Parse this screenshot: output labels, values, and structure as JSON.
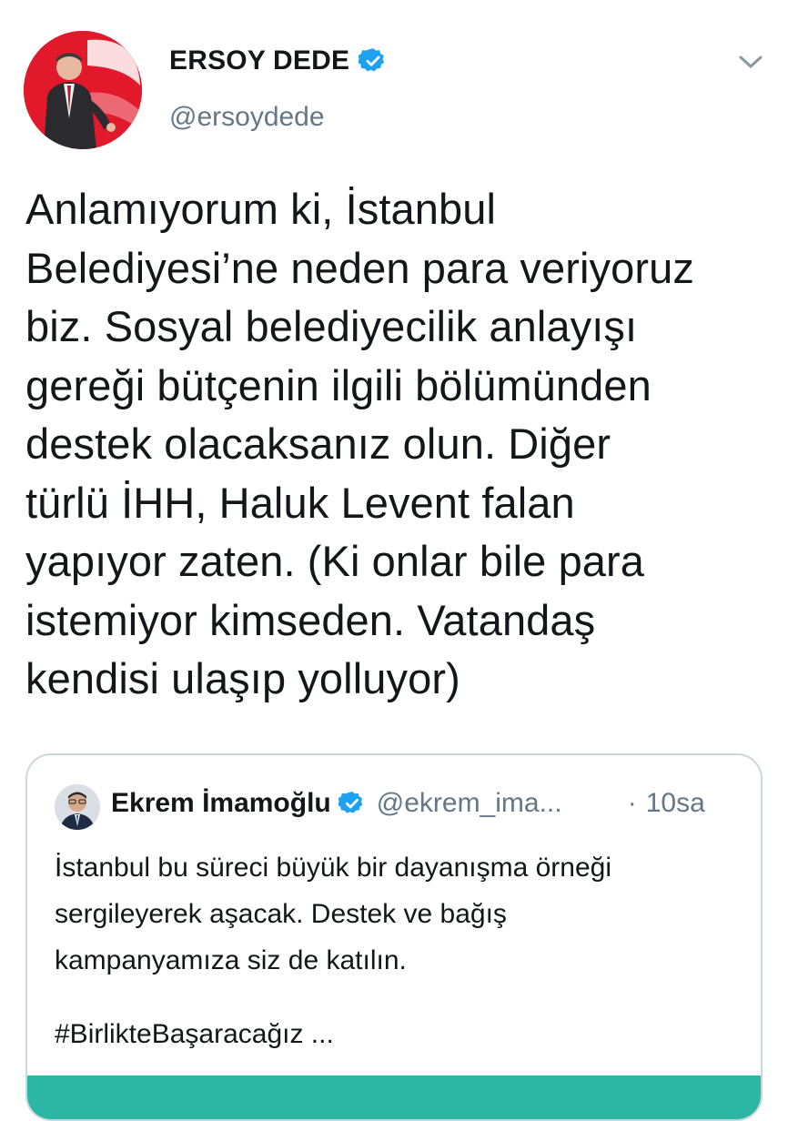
{
  "header": {
    "display_name": "ERSOY DEDE",
    "handle": "@ersoydede",
    "verified_icon": "verified-badge-icon",
    "menu_icon": "chevron-down-icon"
  },
  "tweet": {
    "lines": [
      "Anlamıyorum ki, İstanbul",
      "Belediyesi’ne neden para veriyoruz",
      "biz. Sosyal belediyecilik anlayışı",
      "gereği bütçenin ilgili bölümünden",
      "destek olacaksanız olun. Diğer",
      "türlü İHH, Haluk Levent falan",
      "yapıyor zaten. (Ki onlar bile para",
      "istemiyor kimseden. Vatandaş",
      "kendisi ulaşıp yolluyor)"
    ]
  },
  "quoted_tweet": {
    "display_name": "Ekrem İmamoğlu",
    "handle": "@ekrem_ima...",
    "separator": "·",
    "time": "10sa",
    "lines": [
      "İstanbul bu süreci büyük bir dayanışma örneği",
      "sergileyerek aşacak. Destek ve bağış",
      "kampanyamıza siz de katılın."
    ],
    "hashtag": "#BirlikteBaşaracağız ..."
  },
  "colors": {
    "text": "#14171a",
    "secondary_text": "#657786",
    "verified_blue": "#1da1f2",
    "card_border": "#ccd6dd",
    "media_strip": "#2bb7a3",
    "avatar_red": "#e2182b"
  }
}
